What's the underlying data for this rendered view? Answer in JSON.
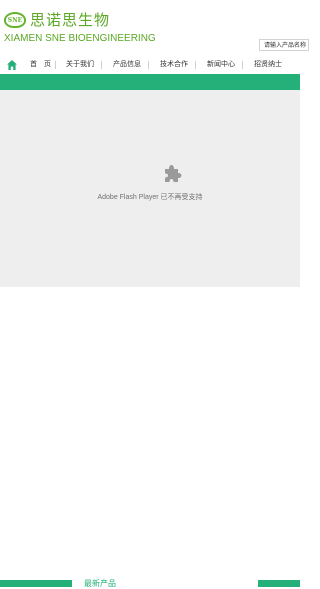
{
  "header": {
    "logo_badge": "SNE",
    "logo_cn": "思诺思生物",
    "logo_en": "XIAMEN SNE BIOENGINEERING",
    "search_placeholder": "请输入产品名称"
  },
  "nav": {
    "home_icon": "home-icon",
    "items": [
      {
        "label": "首　页"
      },
      {
        "label": "关于我们"
      },
      {
        "label": "产品信息"
      },
      {
        "label": "技术合作"
      },
      {
        "label": "新闻中心"
      },
      {
        "label": "招贤纳士"
      }
    ]
  },
  "flash": {
    "icon": "plugin-icon",
    "message": "Adobe Flash Player 已不再受支持"
  },
  "bottom": {
    "section_title": "最新产品"
  },
  "colors": {
    "brand_green": "#5aa824",
    "accent_green": "#25b07a",
    "flash_bg": "#eeeeee"
  }
}
